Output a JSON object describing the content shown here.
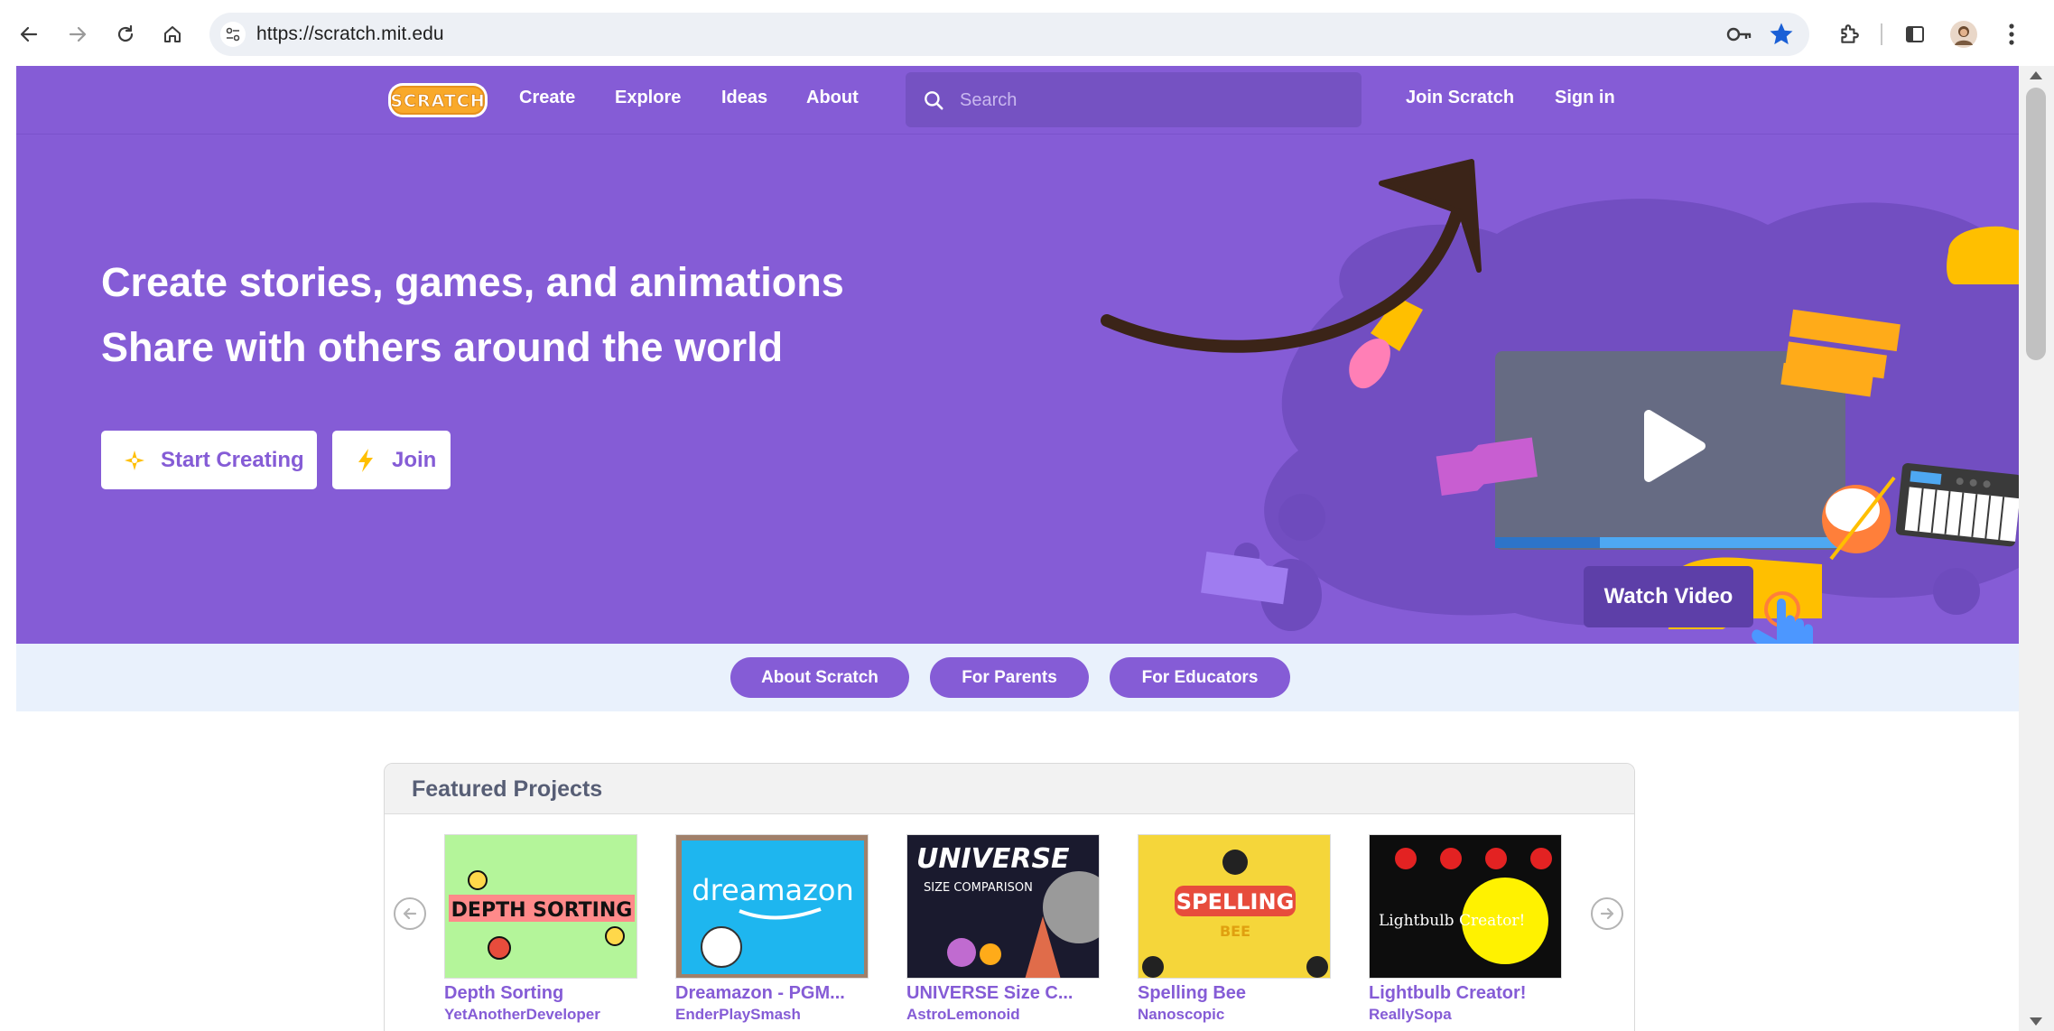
{
  "browser": {
    "url": "https://scratch.mit.edu",
    "icons": [
      "back-icon",
      "forward-icon",
      "reload-icon",
      "home-icon",
      "site-settings-icon",
      "password-key-icon",
      "bookmark-star-icon",
      "extensions-icon",
      "side-panel-icon",
      "profile-avatar",
      "menu-dots-icon"
    ],
    "accent": "#1a73e8"
  },
  "nav": {
    "logo": "Scratch",
    "links": [
      "Create",
      "Explore",
      "Ideas",
      "About"
    ],
    "search_placeholder": "Search",
    "join": "Join Scratch",
    "signin": "Sign in"
  },
  "hero": {
    "line1": "Create stories, games, and animations",
    "line2": "Share with others around the world",
    "start_creating": "Start Creating",
    "join": "Join",
    "watch_video": "Watch Video"
  },
  "subnav": {
    "about": "About Scratch",
    "parents": "For Parents",
    "educators": "For Educators"
  },
  "featured": {
    "title": "Featured Projects",
    "projects": [
      {
        "title": "Depth Sorting",
        "author": "YetAnotherDeveloper",
        "thumb_text": "DEPTH SORTING"
      },
      {
        "title": "Dreamazon - PGM...",
        "author": "EnderPlaySmash",
        "thumb_text": "dreamazon"
      },
      {
        "title": "UNIVERSE Size C...",
        "author": "AstroLemonoid",
        "thumb_text": "UNIVERSE",
        "thumb_sub": "SIZE COMPARISON"
      },
      {
        "title": "Spelling Bee",
        "author": "Nanoscopic",
        "thumb_text": "SPELLING",
        "thumb_sub": "BEE"
      },
      {
        "title": "Lightbulb Creator!",
        "author": "ReallySopa",
        "thumb_text": "Lightbulb Creator!"
      }
    ]
  },
  "colors": {
    "brand_purple": "#855cd6",
    "subnav_bg": "#e9f1fc",
    "arrow_annotation": "#3b2418"
  }
}
